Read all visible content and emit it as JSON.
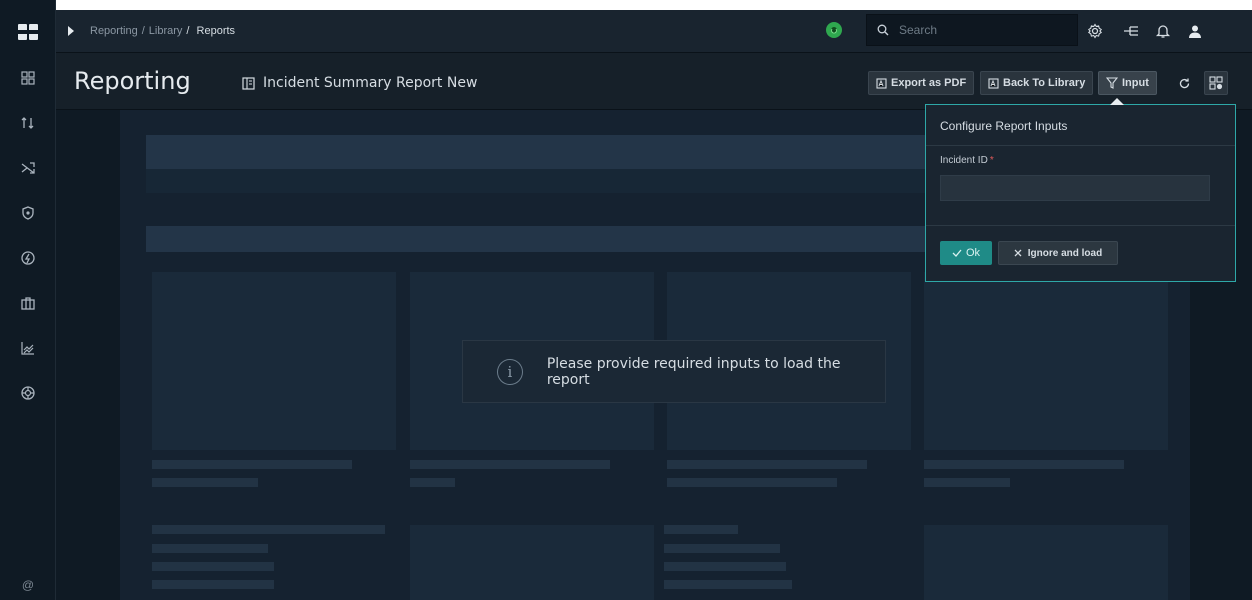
{
  "breadcrumb": {
    "items": [
      "Reporting",
      "Library",
      "Reports"
    ]
  },
  "search": {
    "placeholder": "Search"
  },
  "header": {
    "title": "Reporting",
    "report_name": "Incident Summary Report New",
    "buttons": {
      "export_pdf": "Export as PDF",
      "back_to_library": "Back To Library",
      "input": "Input"
    }
  },
  "notice": {
    "message": "Please provide required inputs to load the report"
  },
  "popover": {
    "title": "Configure Report Inputs",
    "field_label": "Incident ID",
    "required_marker": "*",
    "ok_label": "Ok",
    "ignore_label": "Ignore and load"
  },
  "sidebar": {
    "icons": [
      "dashboard-icon",
      "sort-icon",
      "shuffle-icon",
      "shield-icon",
      "bolt-icon",
      "briefcase-icon",
      "chart-icon",
      "settings-wheel-icon"
    ],
    "bottom_icon_text": "@"
  },
  "colors": {
    "accent": "#2ea8a8",
    "status_green": "#2fa84f",
    "ok_button": "#1f8b87",
    "required": "#e05a5a"
  }
}
